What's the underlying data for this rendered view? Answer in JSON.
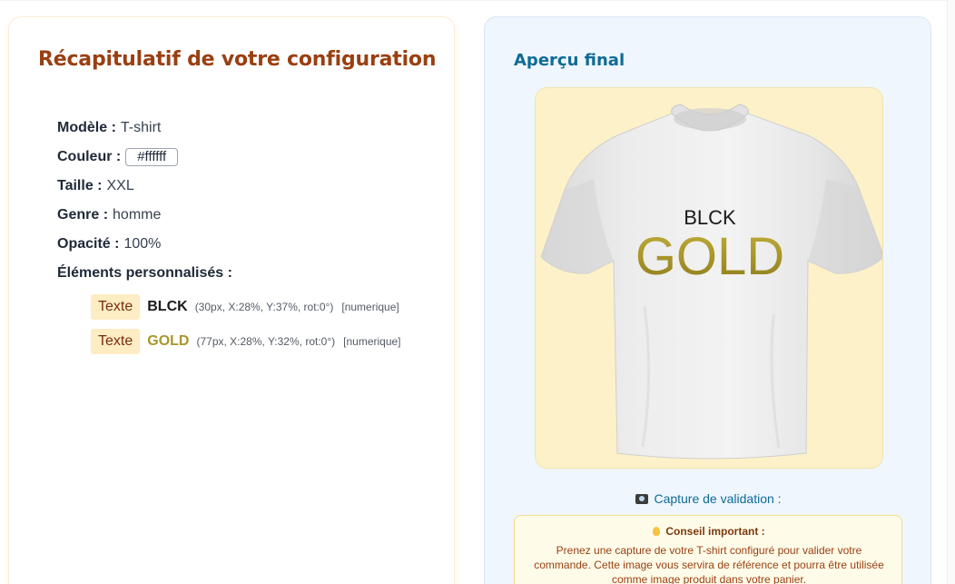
{
  "summary": {
    "title": "Récapitulatif de votre configuration",
    "model": {
      "label": "Modèle :",
      "value": "T-shirt"
    },
    "color": {
      "label": "Couleur :",
      "value": "#ffffff"
    },
    "size": {
      "label": "Taille :",
      "value": "XXL"
    },
    "gender": {
      "label": "Genre :",
      "value": "homme"
    },
    "opacity": {
      "label": "Opacité :",
      "value": "100%"
    },
    "elements_label": "Éléments personnalisés :",
    "elements": [
      {
        "tag": "Texte",
        "text": "BLCK",
        "meta": "(30px, X:28%, Y:37%, rot:0°)",
        "type": "[numerique]",
        "color": "#1a1a1a"
      },
      {
        "tag": "Texte",
        "text": "GOLD",
        "meta": "(77px, X:28%, Y:32%, rot:0°)",
        "type": "[numerique]",
        "color": "#a8962a"
      }
    ]
  },
  "preview": {
    "title": "Aperçu final",
    "shirt_text_top": "BLCK",
    "shirt_text_main": "GOLD",
    "capture_label": "Capture de validation :",
    "tip_title": "Conseil important :",
    "tip_text": "Prenez une capture de votre T-shirt configuré pour valider votre commande. Cette image vous servira de référence et pourra être utilisée comme image produit dans votre panier."
  },
  "colors": {
    "title_brown": "#9a3f12",
    "preview_blue": "#0e6b96",
    "gold": "#a8962a",
    "tag_bg": "#fdecc4"
  },
  "icons": [
    "camera-icon",
    "lightbulb-icon"
  ]
}
